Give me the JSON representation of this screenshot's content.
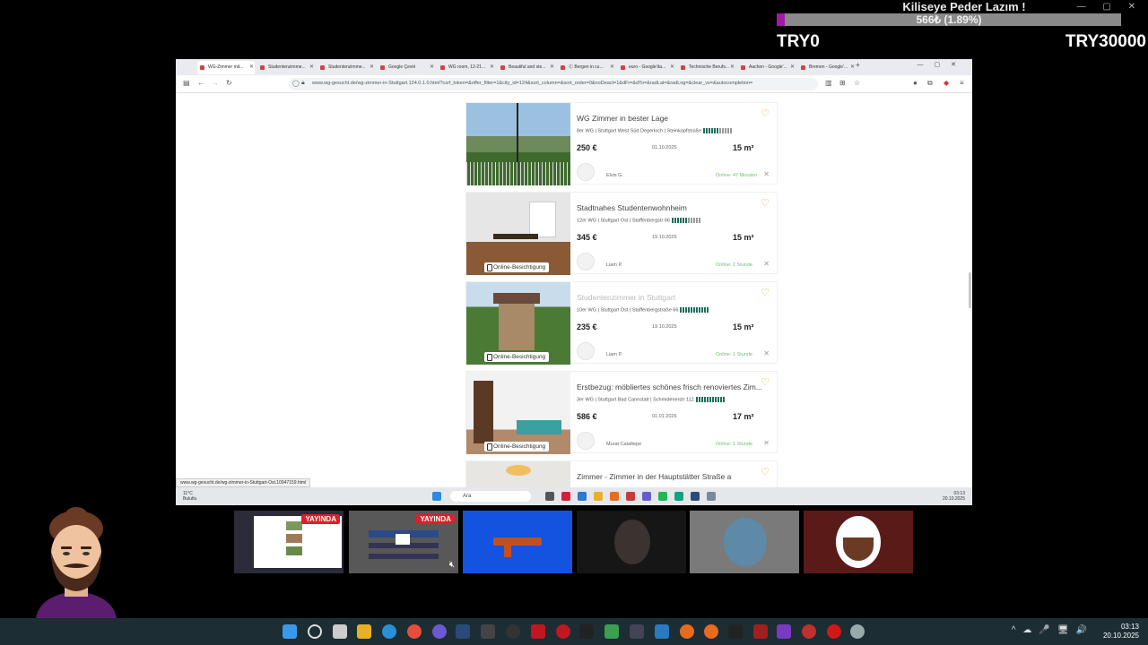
{
  "overlay": {
    "title": "Kiliseye Peder Lazım !",
    "goal_text": "566₺ (1.89%)",
    "goal_progress_pct": 1.89,
    "goal_min": "TRY0",
    "goal_max": "TRY30000"
  },
  "browser": {
    "tabs": [
      {
        "label": "WG-Zimmer mit..."
      },
      {
        "label": "Studentenzimme..."
      },
      {
        "label": "Studentenzimme..."
      },
      {
        "label": "Google Çeviri"
      },
      {
        "label": "WG room, 12-21..."
      },
      {
        "label": "Beautiful and ste..."
      },
      {
        "label": "Ⓒ Bergen in cu..."
      },
      {
        "label": "euro - Google'da..."
      },
      {
        "label": "Technische Berufs..."
      },
      {
        "label": "Aachen - Google'..."
      },
      {
        "label": "Bremen - Google'..."
      }
    ],
    "url": "www.wg-gesucht.de/wg-zimmer-in-Stuttgart.124.0.1.0.html?csrf_token=&offer_filter=1&city_id=124&sort_column=&sort_order=0&noDeact=1&dFr=&dTo=&radLat=&radLng=&clear_vs=&autocompletion=",
    "hover_link": "www.wg-gesucht.de/wg-zimmer-in-Stuttgart-Ost.10947159.html"
  },
  "listings": [
    {
      "title": "WG Zimmer in bester Lage",
      "subtitle": "8er WG | Stuttgart West Süd Degerloch | Steinkopfstraße",
      "price": "250 €",
      "date": "01.10.2025",
      "size": "15 m²",
      "user": "Elvis G.",
      "online": "Online: 47 Minuten",
      "badge": ""
    },
    {
      "title": "Stadtnahes Studentenwohnheim",
      "subtitle": "12er WG | Stuttgart Ost | Staffenbergstr 66",
      "price": "345 €",
      "date": "19.10.2025",
      "size": "15 m²",
      "user": "Liam P.",
      "online": "Online: 1 Stunde",
      "badge": "Online-Besichtigung"
    },
    {
      "title": "Studentenzimmer in Stuttgart",
      "subtitle": "10er WG | Stuttgart Ost | Staffenbergstraße 66",
      "price": "235 €",
      "date": "19.10.2025",
      "size": "15 m²",
      "user": "Liam P.",
      "online": "Online: 1 Stunde",
      "badge": "Online-Besichtigung"
    },
    {
      "title": "Erstbezug: möbliertes schönes frisch renoviertes Zim...",
      "subtitle": "3er WG | Stuttgart Bad Cannstatt | Schmidenerstr 112",
      "price": "586 €",
      "date": "01.01.2026",
      "size": "17 m²",
      "user": "Murat Cataltepe",
      "online": "Online: 1 Stunde",
      "badge": "Online-Besichtigung"
    },
    {
      "title": "Zimmer - Zimmer in der Hauptstätter Straße a"
    }
  ],
  "inner_taskbar": {
    "weather": "11°C",
    "weather_sub": "Bulutlu",
    "search": "Ara",
    "time": "03:13",
    "date": "20.10.2025"
  },
  "thumbnails": {
    "live_label": "YAYINDA"
  },
  "taskbar": {
    "time": "03:13",
    "date": "20.10.2025"
  }
}
